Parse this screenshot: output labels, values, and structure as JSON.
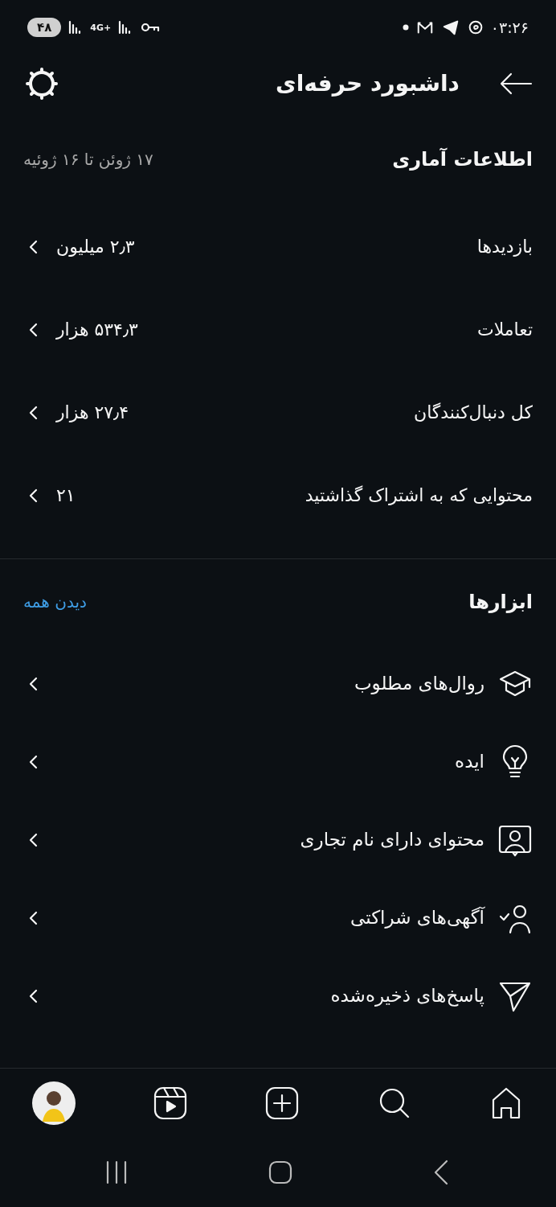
{
  "status_bar": {
    "time": "۰۳:۲۶",
    "battery": "۴۸",
    "network": "4G+"
  },
  "header": {
    "title": "داشبورد حرفه‌ای"
  },
  "insights": {
    "title": "اطلاعات آماری",
    "date_range": "۱۷ ژوئن تا ۱۶ ژوئیه",
    "rows": [
      {
        "label": "بازدیدها",
        "value": "۲٫۳ میلیون"
      },
      {
        "label": "تعاملات",
        "value": "۵۳۴٫۳ هزار"
      },
      {
        "label": "کل دنبال‌کنندگان",
        "value": "۲۷٫۴ هزار"
      },
      {
        "label": "محتوایی که به اشتراک گذاشتید",
        "value": "۲۱"
      }
    ]
  },
  "tools": {
    "title": "ابزارها",
    "see_all": "دیدن همه",
    "items": [
      {
        "kind": "cap",
        "label": "روال‌های مطلوب"
      },
      {
        "kind": "bulb",
        "label": "ایده"
      },
      {
        "kind": "branded",
        "label": "محتوای دارای نام تجاری"
      },
      {
        "kind": "partner",
        "label": "آگهی‌های شراکتی"
      },
      {
        "kind": "send",
        "label": "پاسخ‌های ذخیره‌شده"
      }
    ]
  },
  "nav": {
    "items": [
      {
        "kind": "home"
      },
      {
        "kind": "search"
      },
      {
        "kind": "create"
      },
      {
        "kind": "reels"
      },
      {
        "kind": "profile"
      }
    ]
  }
}
